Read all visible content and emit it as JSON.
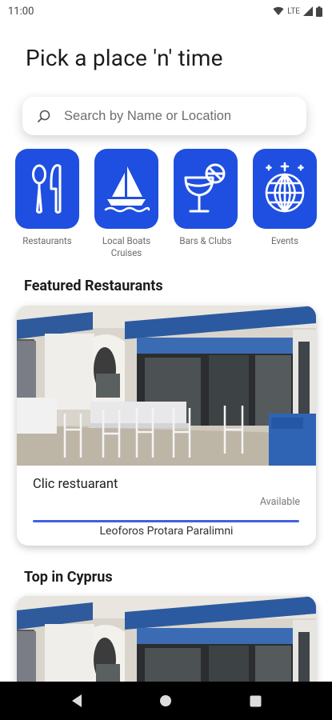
{
  "status_bar": {
    "time": "11:00",
    "network": "LTE"
  },
  "header": {
    "title": "Pick a place 'n' time"
  },
  "search": {
    "placeholder": "Search by Name or Location",
    "value": ""
  },
  "categories": [
    {
      "label": "Restaurants",
      "icon": "cutlery-icon"
    },
    {
      "label": "Local Boats\nCruises",
      "icon": "sailboat-icon"
    },
    {
      "label": "Bars & Clubs",
      "icon": "cocktail-icon"
    },
    {
      "label": "Events",
      "icon": "disco-ball-icon"
    }
  ],
  "featured": {
    "title": "Featured Restaurants",
    "card": {
      "name": "Clic restuarant",
      "status": "Available",
      "address": "Leoforos Protara Paralimni",
      "progress": 1.0
    }
  },
  "top": {
    "title": "Top in Cyprus"
  },
  "colors": {
    "accent": "#1f4fe0",
    "progress": "#3e63dd"
  }
}
